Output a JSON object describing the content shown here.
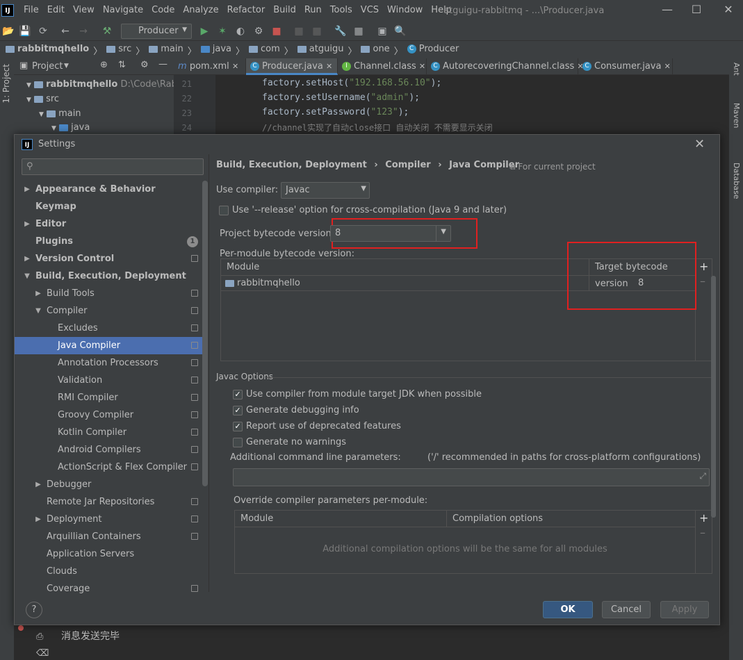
{
  "ide": {
    "logo": "IJ",
    "menus": [
      "File",
      "Edit",
      "View",
      "Navigate",
      "Code",
      "Analyze",
      "Refactor",
      "Build",
      "Run",
      "Tools",
      "VCS",
      "Window",
      "Help"
    ],
    "window_title": "atguigu-rabbitmq - ...\\Producer.java",
    "run_config": "Producer",
    "breadcrumbs": [
      "rabbitmqhello",
      "src",
      "main",
      "java",
      "com",
      "atguigu",
      "one",
      "Producer"
    ],
    "left_tool_window": "1: Project",
    "right_tool_windows": [
      "Ant",
      "Maven",
      "Database"
    ],
    "project_panel": {
      "title": "Project",
      "tree": [
        {
          "label": "rabbitmqhello",
          "path": "D:\\Code\\RabbitM"
        },
        {
          "label": "src"
        },
        {
          "label": "main"
        },
        {
          "label": "java"
        }
      ]
    },
    "editor_tabs": [
      "pom.xml",
      "Producer.java",
      "Channel.class",
      "AutorecoveringChannel.class",
      "Consumer.java"
    ],
    "active_tab": "Producer.java",
    "line_numbers": [
      "21",
      "22",
      "23",
      "24"
    ],
    "code": {
      "l21_a": "factory.setHost(",
      "l21_s": "\"192.168.56.10\"",
      "l21_b": ");",
      "l22_a": "factory.setUsername(",
      "l22_s": "\"admin\"",
      "l22_b": ");",
      "l23_a": "factory.setPassword(",
      "l23_s": "\"123\"",
      "l23_b": ");",
      "l24": "//channel实现了自动close接口 自动关闭 不需要显示关闭"
    },
    "console_text": "消息发送完毕"
  },
  "dialog": {
    "icon": "IJ",
    "title": "Settings",
    "search_placeholder": "",
    "tree": [
      {
        "label": "Appearance & Behavior",
        "bold": true,
        "arrow": "right",
        "indent": 0
      },
      {
        "label": "Keymap",
        "bold": true,
        "indent": 0
      },
      {
        "label": "Editor",
        "bold": true,
        "arrow": "right",
        "indent": 0
      },
      {
        "label": "Plugins",
        "bold": true,
        "indent": 0,
        "badge": "1"
      },
      {
        "label": "Version Control",
        "bold": true,
        "arrow": "right",
        "indent": 0,
        "proj": true
      },
      {
        "label": "Build, Execution, Deployment",
        "bold": true,
        "arrow": "down",
        "indent": 0
      },
      {
        "label": "Build Tools",
        "arrow": "right",
        "indent": 1,
        "proj": true
      },
      {
        "label": "Compiler",
        "arrow": "down",
        "indent": 1,
        "proj": true
      },
      {
        "label": "Excludes",
        "indent": 2,
        "proj": true
      },
      {
        "label": "Java Compiler",
        "indent": 2,
        "proj": true,
        "selected": true
      },
      {
        "label": "Annotation Processors",
        "indent": 2,
        "proj": true
      },
      {
        "label": "Validation",
        "indent": 2,
        "proj": true
      },
      {
        "label": "RMI Compiler",
        "indent": 2,
        "proj": true
      },
      {
        "label": "Groovy Compiler",
        "indent": 2,
        "proj": true
      },
      {
        "label": "Kotlin Compiler",
        "indent": 2,
        "proj": true
      },
      {
        "label": "Android Compilers",
        "indent": 2,
        "proj": true
      },
      {
        "label": "ActionScript & Flex Compiler",
        "indent": 2,
        "proj": true
      },
      {
        "label": "Debugger",
        "arrow": "right",
        "indent": 1
      },
      {
        "label": "Remote Jar Repositories",
        "indent": 1,
        "proj": true
      },
      {
        "label": "Deployment",
        "arrow": "right",
        "indent": 1,
        "proj": true
      },
      {
        "label": "Arquillian Containers",
        "indent": 1,
        "proj": true
      },
      {
        "label": "Application Servers",
        "indent": 1
      },
      {
        "label": "Clouds",
        "indent": 1
      },
      {
        "label": "Coverage",
        "indent": 1,
        "proj": true
      }
    ],
    "breadcrumb": [
      "Build, Execution, Deployment",
      "Compiler",
      "Java Compiler"
    ],
    "breadcrumb_sep": "›",
    "scope_note": "For current project",
    "use_compiler_label": "Use compiler:",
    "use_compiler_value": "Javac",
    "release_option_label": "Use '--release' option for cross-compilation (Java 9 and later)",
    "release_option_checked": false,
    "project_bytecode_label": "Project bytecode version:",
    "project_bytecode_value": "8",
    "per_module_label": "Per-module bytecode version:",
    "module_table": {
      "columns": [
        "Module",
        "Target bytecode version"
      ],
      "rows": [
        {
          "module": "rabbitmqhello",
          "version": "8"
        }
      ]
    },
    "javac_section": "Javac Options",
    "options": [
      {
        "label": "Use compiler from module target JDK when possible",
        "checked": true
      },
      {
        "label": "Generate debugging info",
        "checked": true
      },
      {
        "label": "Report use of deprecated features",
        "checked": true
      },
      {
        "label": "Generate no warnings",
        "checked": false
      }
    ],
    "additional_params_label": "Additional command line parameters:",
    "additional_params_hint": "('/' recommended in paths for cross-platform configurations)",
    "additional_params_value": "",
    "override_label": "Override compiler parameters per-module:",
    "override_table": {
      "columns": [
        "Module",
        "Compilation options"
      ],
      "empty_text": "Additional compilation options will be the same for all modules"
    },
    "buttons": {
      "ok": "OK",
      "cancel": "Cancel",
      "apply": "Apply",
      "help": "?"
    }
  },
  "colors": {
    "selection": "#4b6eaf",
    "highlight_box": "#e02020",
    "string": "#6a8759",
    "comment": "#808080"
  }
}
